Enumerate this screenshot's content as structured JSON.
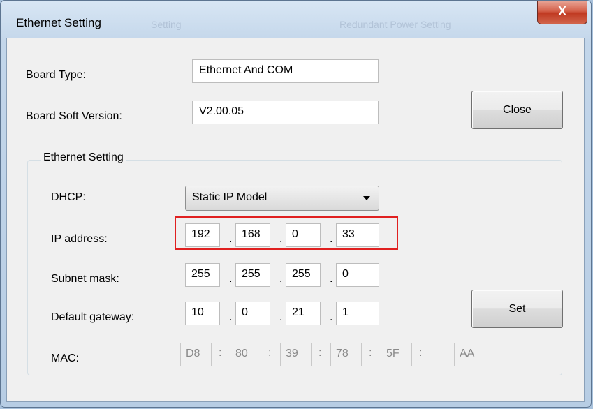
{
  "window": {
    "title": "Ethernet Setting",
    "close_glyph": "X",
    "ghost_tabs": [
      "Setting",
      "Redundant Power Setting"
    ]
  },
  "board": {
    "type_label": "Board Type:",
    "type_value": "Ethernet And COM",
    "version_label": "Board Soft Version:",
    "version_value": "V2.00.05"
  },
  "buttons": {
    "close": "Close",
    "set": "Set"
  },
  "ethernet": {
    "group_title": "Ethernet Setting",
    "dhcp_label": "DHCP:",
    "dhcp_value": "Static IP Model",
    "ip_label": "IP address:",
    "ip": [
      "192",
      "168",
      "0",
      "33"
    ],
    "mask_label": "Subnet mask:",
    "mask": [
      "255",
      "255",
      "255",
      "0"
    ],
    "gateway_label": "Default gateway:",
    "gateway": [
      "10",
      "0",
      "21",
      "1"
    ],
    "mac_label": "MAC:",
    "mac": [
      "D8",
      "80",
      "39",
      "78",
      "5F",
      "AA"
    ],
    "dot": ".",
    "colon": ":"
  },
  "colors": {
    "highlight": "#e02020",
    "close_button": "#c03a22"
  }
}
